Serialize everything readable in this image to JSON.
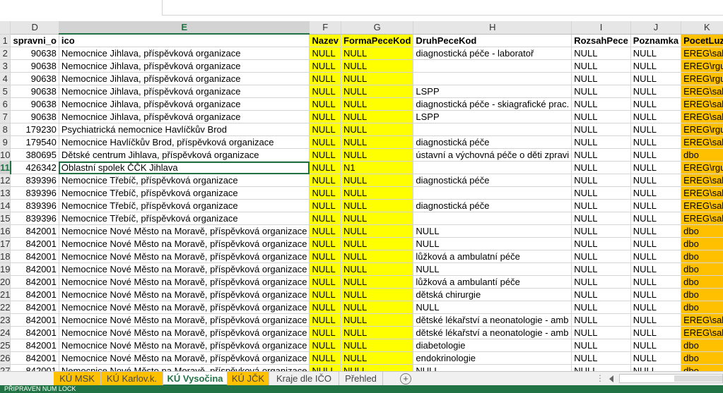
{
  "column_headers": [
    "D",
    "E",
    "F",
    "G",
    "H",
    "I",
    "J",
    "K"
  ],
  "header_row": {
    "row": "1",
    "cells": [
      "spravni_o",
      "ico",
      "Nazev",
      "FormaPeceKod",
      "DruhPeceKod",
      "RozsahPece",
      "Poznamka",
      "PocetLuze"
    ]
  },
  "rows": [
    {
      "row": "2",
      "d": "90638",
      "e": "Nemocnice Jihlava, příspěvková organizace",
      "f": "NULL",
      "g": "NULL",
      "h": "diagnostická péče - laboratoř",
      "i": "NULL",
      "j": "NULL",
      "k": "EREG\\sala"
    },
    {
      "row": "3",
      "d": "90638",
      "e": "Nemocnice Jihlava, příspěvková organizace",
      "f": "NULL",
      "g": "NULL",
      "h": "",
      "i": "NULL",
      "j": "NULL",
      "k": "EREG\\rgu_"
    },
    {
      "row": "4",
      "d": "90638",
      "e": "Nemocnice Jihlava, příspěvková organizace",
      "f": "NULL",
      "g": "NULL",
      "h": "",
      "i": "NULL",
      "j": "NULL",
      "k": "EREG\\rgu_"
    },
    {
      "row": "5",
      "d": "90638",
      "e": "Nemocnice Jihlava, příspěvková organizace",
      "f": "NULL",
      "g": "NULL",
      "h": "LSPP",
      "i": "NULL",
      "j": "NULL",
      "k": "EREG\\sala"
    },
    {
      "row": "6",
      "d": "90638",
      "e": "Nemocnice Jihlava, příspěvková organizace",
      "f": "NULL",
      "g": "NULL",
      "h": "diagnostická péče - skiagrafické prac.",
      "i": "NULL",
      "j": "NULL",
      "k": "EREG\\sala"
    },
    {
      "row": "7",
      "d": "90638",
      "e": "Nemocnice Jihlava, příspěvková organizace",
      "f": "NULL",
      "g": "NULL",
      "h": "LSPP",
      "i": "NULL",
      "j": "NULL",
      "k": "EREG\\sala"
    },
    {
      "row": "8",
      "d": "179230",
      "e": "Psychiatrická nemocnice Havlíčkův Brod",
      "f": "NULL",
      "g": "NULL",
      "h": "",
      "i": "NULL",
      "j": "NULL",
      "k": "EREG\\rgu_"
    },
    {
      "row": "9",
      "d": "179540",
      "e": "Nemocnice Havlíčkův Brod, příspěvková organizace",
      "f": "NULL",
      "g": "NULL",
      "h": "diagnostická péče",
      "i": "NULL",
      "j": "NULL",
      "k": "EREG\\sala"
    },
    {
      "row": "10",
      "d": "380695",
      "e": "Dětské centrum Jihlava, příspěvková organizace",
      "f": "NULL",
      "g": "NULL",
      "h": "ústavní a výchovná péče o děti zpravi",
      "i": "NULL",
      "j": "NULL",
      "k": "dbo"
    },
    {
      "row": "11",
      "d": "426342",
      "e": "Oblastní spolek ČČK Jihlava",
      "f": "NULL",
      "g": "N1",
      "h": "",
      "i": "NULL",
      "j": "NULL",
      "k": "EREG\\rgu_"
    },
    {
      "row": "12",
      "d": "839396",
      "e": "Nemocnice Třebíč, příspěvková organizace",
      "f": "NULL",
      "g": "NULL",
      "h": "diagnostická péče",
      "i": "NULL",
      "j": "NULL",
      "k": "EREG\\sala"
    },
    {
      "row": "13",
      "d": "839396",
      "e": "Nemocnice Třebíč, příspěvková organizace",
      "f": "NULL",
      "g": "NULL",
      "h": "",
      "i": "NULL",
      "j": "NULL",
      "k": "EREG\\sala"
    },
    {
      "row": "14",
      "d": "839396",
      "e": "Nemocnice Třebíč, příspěvková organizace",
      "f": "NULL",
      "g": "NULL",
      "h": "diagnostická péče",
      "i": "NULL",
      "j": "NULL",
      "k": "EREG\\sala"
    },
    {
      "row": "15",
      "d": "839396",
      "e": "Nemocnice Třebíč, příspěvková organizace",
      "f": "NULL",
      "g": "NULL",
      "h": "",
      "i": "NULL",
      "j": "NULL",
      "k": "EREG\\sala"
    },
    {
      "row": "16",
      "d": "842001",
      "e": "Nemocnice Nové Město na Moravě, příspěvková organizace",
      "f": "NULL",
      "g": "NULL",
      "h": "NULL",
      "i": "NULL",
      "j": "NULL",
      "k": "dbo"
    },
    {
      "row": "17",
      "d": "842001",
      "e": "Nemocnice Nové Město na Moravě, příspěvková organizace",
      "f": "NULL",
      "g": "NULL",
      "h": "NULL",
      "i": "NULL",
      "j": "NULL",
      "k": "dbo"
    },
    {
      "row": "18",
      "d": "842001",
      "e": "Nemocnice Nové Město na Moravě, příspěvková organizace",
      "f": "NULL",
      "g": "NULL",
      "h": "lůžková a ambulatní péče",
      "i": "NULL",
      "j": "NULL",
      "k": "dbo"
    },
    {
      "row": "19",
      "d": "842001",
      "e": "Nemocnice Nové Město na Moravě, příspěvková organizace",
      "f": "NULL",
      "g": "NULL",
      "h": "NULL",
      "i": "NULL",
      "j": "NULL",
      "k": "dbo"
    },
    {
      "row": "20",
      "d": "842001",
      "e": "Nemocnice Nové Město na Moravě, příspěvková organizace",
      "f": "NULL",
      "g": "NULL",
      "h": "lůžková a ambulantí péče",
      "i": "NULL",
      "j": "NULL",
      "k": "dbo"
    },
    {
      "row": "21",
      "d": "842001",
      "e": "Nemocnice Nové Město na Moravě, příspěvková organizace",
      "f": "NULL",
      "g": "NULL",
      "h": "dětská chirurgie",
      "i": "NULL",
      "j": "NULL",
      "k": "dbo"
    },
    {
      "row": "22",
      "d": "842001",
      "e": "Nemocnice Nové Město na Moravě, příspěvková organizace",
      "f": "NULL",
      "g": "NULL",
      "h": "NULL",
      "i": "NULL",
      "j": "NULL",
      "k": "dbo"
    },
    {
      "row": "23",
      "d": "842001",
      "e": "Nemocnice Nové Město na Moravě, příspěvková organizace",
      "f": "NULL",
      "g": "NULL",
      "h": "dětské lékařství a neonatologie - amb",
      "i": "NULL",
      "j": "NULL",
      "k": "EREG\\sala"
    },
    {
      "row": "24",
      "d": "842001",
      "e": "Nemocnice Nové Město na Moravě, příspěvková organizace",
      "f": "NULL",
      "g": "NULL",
      "h": "dětské lékařství a neonatologie - amb",
      "i": "NULL",
      "j": "NULL",
      "k": "EREG\\sala"
    },
    {
      "row": "25",
      "d": "842001",
      "e": "Nemocnice Nové Město na Moravě, příspěvková organizace",
      "f": "NULL",
      "g": "NULL",
      "h": "diabetologie",
      "i": "NULL",
      "j": "NULL",
      "k": "dbo"
    },
    {
      "row": "26",
      "d": "842001",
      "e": "Nemocnice Nové Město na Moravě, příspěvková organizace",
      "f": "NULL",
      "g": "NULL",
      "h": "endokrinologie",
      "i": "NULL",
      "j": "NULL",
      "k": "dbo"
    },
    {
      "row": "27",
      "d": "842001",
      "e": "Nemocnice Nové Město na Moravě, příspěvková organizace",
      "f": "NULL",
      "g": "NULL",
      "h": "NULL",
      "i": "NULL",
      "j": "NULL",
      "k": "dbo"
    }
  ],
  "active_column": "E",
  "active_row": "11",
  "sheet_tabs": [
    {
      "label": "KÚ MSK",
      "style": "orange"
    },
    {
      "label": "KÚ Karlov.k.",
      "style": "orange"
    },
    {
      "label": "KÚ Vysočina",
      "style": "active"
    },
    {
      "label": "KÚ JČK",
      "style": "orange"
    },
    {
      "label": "Kraje dle IČO",
      "style": "plain"
    },
    {
      "label": "Přehled",
      "style": "plain"
    }
  ],
  "add_sheet_label": "+",
  "scroll_dots": "⋮",
  "status_text": "PŘIPRAVEN    NUM LOCK",
  "colors": {
    "yellow_fill": "#ffff00",
    "orange_fill": "#ffc000",
    "excel_green": "#217346"
  }
}
